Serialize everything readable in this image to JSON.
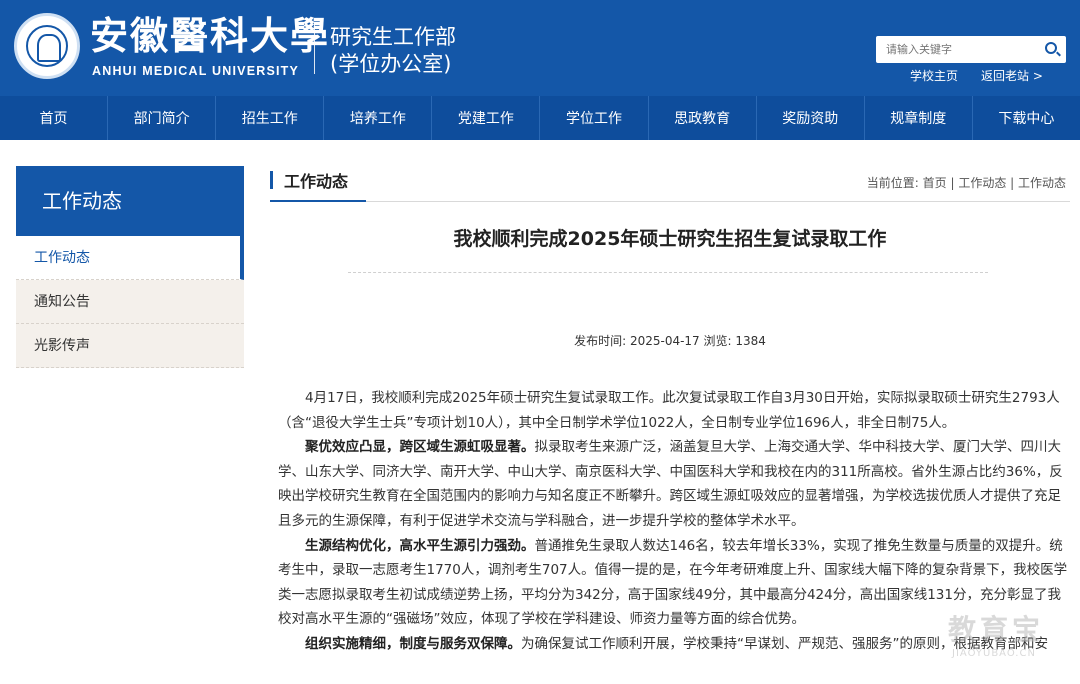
{
  "header": {
    "logo_cn": "安徽醫科大學",
    "logo_en": "ANHUI MEDICAL UNIVERSITY",
    "dept_line1": "研究生工作部",
    "dept_line2": "(学位办公室)",
    "search_placeholder": "请输入关键字",
    "quick_links": [
      "学校主页",
      "返回老站 >"
    ]
  },
  "nav": [
    "首页",
    "部门简介",
    "招生工作",
    "培养工作",
    "党建工作",
    "学位工作",
    "思政教育",
    "奖励资助",
    "规章制度",
    "下载中心"
  ],
  "sidebar": {
    "title": "工作动态",
    "items": [
      "工作动态",
      "通知公告",
      "光影传声"
    ],
    "active_index": 0
  },
  "main": {
    "section_title": "工作动态",
    "breadcrumb": "当前位置: 首页 | 工作动态 | 工作动态",
    "article_title": "我校顺利完成2025年硕士研究生招生复试录取工作",
    "meta": "发布时间: 2025-04-17 浏览: 1384",
    "paragraphs": [
      {
        "lead": "",
        "text": "4月17日，我校顺利完成2025年硕士研究生复试录取工作。此次复试录取工作自3月30日开始，实际拟录取硕士研究生2793人（含“退役大学生士兵”专项计划10人），其中全日制学术学位1022人，全日制专业学位1696人，非全日制75人。"
      },
      {
        "lead": "聚优效应凸显，跨区域生源虹吸显著。",
        "text": "拟录取考生来源广泛，涵盖复旦大学、上海交通大学、华中科技大学、厦门大学、四川大学、山东大学、同济大学、南开大学、中山大学、南京医科大学、中国医科大学和我校在内的311所高校。省外生源占比约36%，反映出学校研究生教育在全国范围内的影响力与知名度正不断攀升。跨区域生源虹吸效应的显著增强，为学校选拔优质人才提供了充足且多元的生源保障，有利于促进学术交流与学科融合，进一步提升学校的整体学术水平。"
      },
      {
        "lead": "生源结构优化，高水平生源引力强劲。",
        "text": "普通推免生录取人数达146名，较去年增长33%，实现了推免生数量与质量的双提升。统考生中，录取一志愿考生1770人，调剂考生707人。值得一提的是，在今年考研难度上升、国家线大幅下降的复杂背景下，我校医学类一志愿拟录取考生初试成绩逆势上扬，平均分为342分，高于国家线49分，其中最高分424分，高出国家线131分，充分彰显了我校对高水平生源的“强磁场”效应，体现了学校在学科建设、师资力量等方面的综合优势。"
      },
      {
        "lead": "组织实施精细，制度与服务双保障。",
        "text": "为确保复试工作顺利开展，学校秉持“早谋划、严规范、强服务”的原则，根据教育部和安"
      }
    ]
  },
  "watermark": {
    "line1": "教育宝",
    "line2": "JIAOYUBAO.CN"
  }
}
